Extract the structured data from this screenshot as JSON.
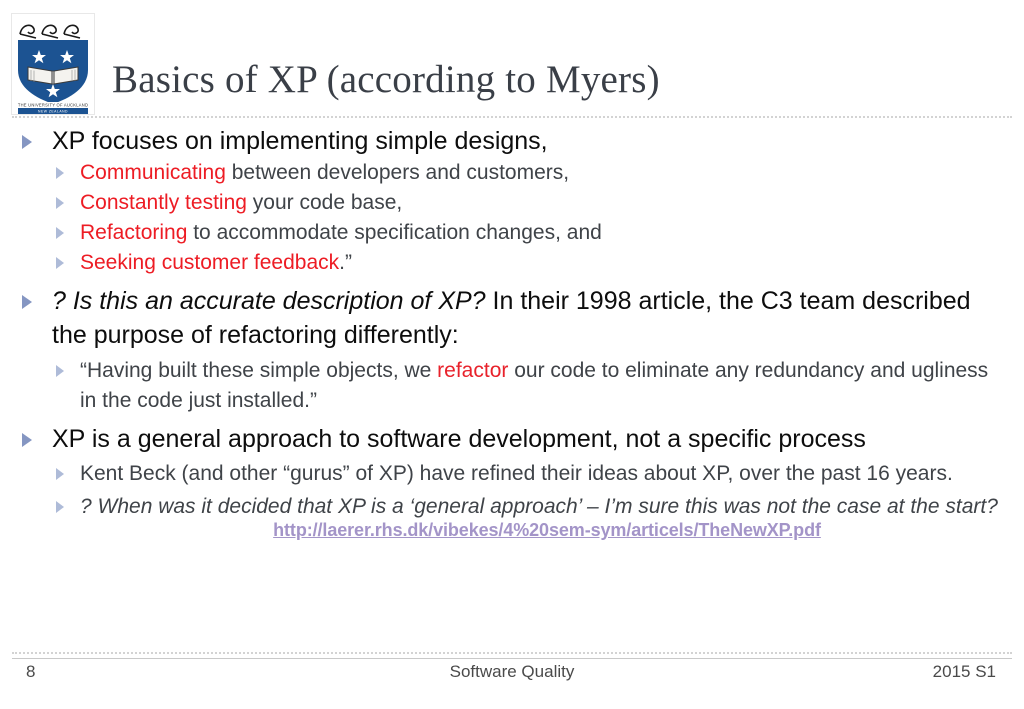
{
  "slide": {
    "title": "Basics of XP (according to Myers)",
    "logo_alt": "The University of Auckland crest",
    "logo_caption": "THE UNIVERSITY OF AUCKLAND",
    "logo_subcaption": "NEW ZEALAND"
  },
  "colors": {
    "title": "#3a3f47",
    "accent_red": "#ed1c24",
    "bullet_level1": "#8596c2",
    "bullet_level2": "#aebbd8",
    "body_dark": "#3f4348",
    "body_black": "#0d0d0d",
    "link_purple": "#a394c8",
    "rule": "#d3d3d3"
  },
  "content": {
    "b1": {
      "text": "XP focuses on implementing simple designs,"
    },
    "b1_sub1": {
      "red": "Communicating",
      "rest": " between developers and customers,"
    },
    "b1_sub2": {
      "red": "Constantly testing",
      "rest": " your code base,"
    },
    "b1_sub3": {
      "red": "Refactoring",
      "rest": " to accommodate specification changes, and"
    },
    "b1_sub4": {
      "red": "Seeking customer feedback",
      "rest": ".”"
    },
    "b2": {
      "italic": "? Is this an accurate description of XP?",
      "rest": "  In their 1998 article, the C3 team described the purpose of refactoring differently:"
    },
    "b2_sub1": {
      "pre": "“Having built these simple objects, we ",
      "red": "refactor",
      "post": " our code to eliminate any redundancy and ugliness in the code just installed.”"
    },
    "b3": {
      "text": "XP is a general approach to software development, not a specific process"
    },
    "b3_sub1": {
      "text": "Kent Beck (and other “gurus” of XP) have refined their ideas about XP, over the past 16 years."
    },
    "b3_sub2": {
      "text": "? When was it decided that XP is a ‘general approach’ – I’m sure this was not the case at the start?"
    },
    "link": {
      "label": "http://laerer.rhs.dk/vibekes/4%20sem-sym/articels/TheNewXP.pdf"
    }
  },
  "footer": {
    "page_number": "8",
    "course": "Software Quality",
    "semester": "2015 S1"
  }
}
